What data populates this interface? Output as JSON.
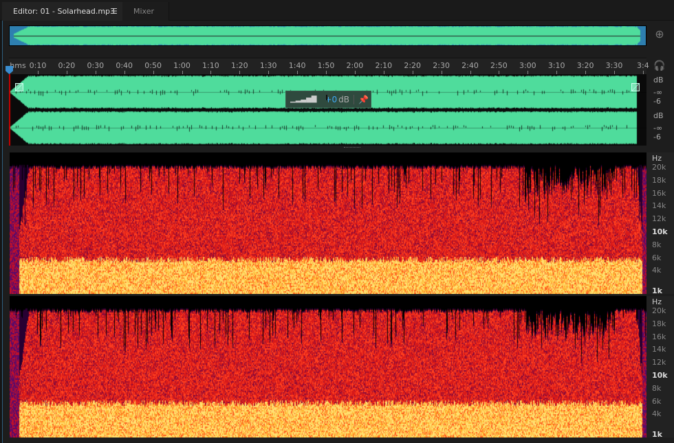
{
  "tabs": [
    {
      "label": "Editor: 01 - Solarhead.mp3",
      "active": true
    },
    {
      "label": "Mixer",
      "active": false
    }
  ],
  "icons": {
    "menu": "hamburger-menu-icon",
    "zoom": "zoom-magnifier-icon",
    "monitor": "headphones-monitor-icon",
    "pin": "pin-icon",
    "level": "level-meter-icon"
  },
  "ruler": {
    "unit": "hms",
    "labels": [
      "0:10",
      "0:20",
      "0:30",
      "0:40",
      "0:50",
      "1:00",
      "1:10",
      "1:20",
      "1:30",
      "1:40",
      "1:50",
      "2:00",
      "2:10",
      "2:20",
      "2:30",
      "2:40",
      "2:50",
      "3:00",
      "3:10",
      "3:20",
      "3:30",
      "3:4"
    ]
  },
  "hud": {
    "value": "+0",
    "unit": "dB"
  },
  "amplitude_axis": {
    "unit": "dB",
    "labels": [
      "-∞",
      "-6"
    ]
  },
  "frequency_axis": {
    "unit": "Hz",
    "labels": [
      "20k",
      "18k",
      "16k",
      "14k",
      "12k",
      "10k",
      "8k",
      "6k",
      "4k",
      "1k"
    ]
  },
  "colors": {
    "waveform": "#4fdc9c",
    "accent": "#3a8ed0"
  }
}
